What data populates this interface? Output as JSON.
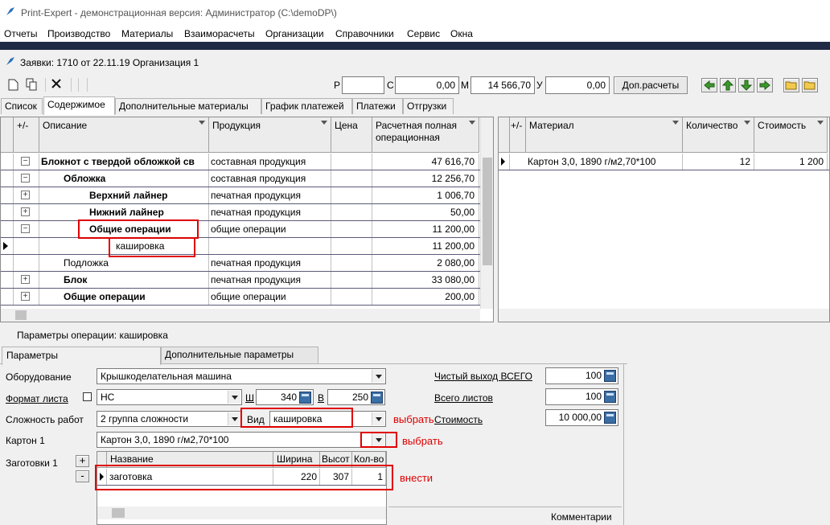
{
  "window": {
    "title": "Print-Expert - демонстрационная версия: Администратор (C:\\demoDP\\)"
  },
  "menu": [
    "Отчеты",
    "Производство",
    "Материалы",
    "Взаиморасчеты",
    "Организации",
    "Справочники",
    "Сервис",
    "Окна"
  ],
  "subwindow": {
    "title": "Заявки: 1710 от 22.11.19  Организация 1"
  },
  "toolbar": {
    "r_label": "Р",
    "r_value": "",
    "c_label": "С",
    "c_value": "0,00",
    "m_label": "М",
    "m_value": "14 566,70",
    "u_label": "У",
    "u_value": "0,00",
    "extra_button": "Доп.расчеты"
  },
  "tabs": [
    "Список",
    "Содержимое",
    "Дополнительные материалы",
    "График платежей",
    "Платежи",
    "Отгрузки"
  ],
  "main_grid": {
    "headers": [
      "+/-",
      "Описание",
      "Продукция",
      "Цена",
      "Расчетная полная операционная"
    ],
    "rows": [
      {
        "pm": "−",
        "desc": "Блокнот с твердой обложкой св",
        "prod": "составная продукция",
        "price": "",
        "total": "47 616,70"
      },
      {
        "pm": "−",
        "desc": "Обложка",
        "prod": "составная продукция",
        "price": "",
        "total": "12 256,70"
      },
      {
        "pm": "+",
        "desc": "Верхний лайнер",
        "prod": "печатная продукция",
        "price": "",
        "total": "1 006,70"
      },
      {
        "pm": "+",
        "desc": "Нижний лайнер",
        "prod": "печатная продукция",
        "price": "",
        "total": "50,00"
      },
      {
        "pm": "−",
        "desc": "Общие операции",
        "prod": "общие операции",
        "price": "",
        "total": "11 200,00"
      },
      {
        "pm": "",
        "desc": "кашировка",
        "prod": "",
        "price": "",
        "total": "11 200,00"
      },
      {
        "pm": "",
        "desc": "Подложка",
        "prod": "печатная продукция",
        "price": "",
        "total": "2 080,00"
      },
      {
        "pm": "+",
        "desc": "Блок",
        "prod": "печатная продукция",
        "price": "",
        "total": "33 080,00"
      },
      {
        "pm": "+",
        "desc": "Общие операции",
        "prod": "общие операции",
        "price": "",
        "total": "200,00"
      }
    ]
  },
  "material_grid": {
    "headers": [
      "+/-",
      "Материал",
      "Количество",
      "Стоимость"
    ],
    "rows": [
      {
        "name": "Картон 3,0, 1890 г/м2,70*100",
        "qty": "12",
        "cost": "1 200"
      }
    ]
  },
  "params": {
    "title": "Параметры операции: кашировка",
    "tab_main": "Параметры",
    "tab_extra": "Дополнительные параметры",
    "equipment_label": "Оборудование",
    "equipment_value": "Крышкоделательная машина",
    "format_label": "Формат листа",
    "format_value": "НС",
    "w_label": "Ш",
    "w_value": "340",
    "h_label": "В",
    "h_value": "250",
    "complexity_label": "Сложность работ",
    "complexity_value": "2 группа сложности",
    "kind_label": "Вид",
    "kind_value": "кашировка",
    "carton_label": "Картон 1",
    "carton_value": "Картон 3,0, 1890 г/м2,70*100",
    "blanks_label": "Заготовки 1",
    "blanks_headers": [
      "Название",
      "Ширина",
      "Высот",
      "Кол-во"
    ],
    "blanks_rows": [
      {
        "name": "заготовка",
        "w": "220",
        "h": "307",
        "qty": "1"
      }
    ],
    "net_label": "Чистый выход ВСЕГО",
    "net_value": "100",
    "sheets_label": "Всего листов",
    "sheets_value": "100",
    "cost_label": "Стоимость",
    "cost_value": "10 000,00",
    "comments_label": "Комментарии"
  },
  "annotations": {
    "choose1": "выбрать",
    "choose2": "выбрать",
    "enter": "внести"
  },
  "colors": {
    "dark_bar": "#1f2a44",
    "highlight": "#e00000",
    "grid_line": "#5a5a78"
  }
}
